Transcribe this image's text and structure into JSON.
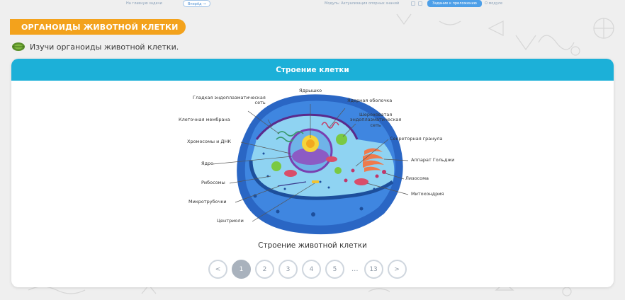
{
  "topbar": {
    "back_link": "На главную задачи",
    "next_pill": "Вперёд →",
    "mid_text": "Модуль: Актуализация опорных знаний",
    "cta_label": "Задание к приложению",
    "right_link": "О модуле"
  },
  "banner": {
    "title": "ОРГАНОИДЫ ЖИВОТНОЙ КЛЕТКИ"
  },
  "task": {
    "text": "Изучи органоиды животной клетки."
  },
  "card": {
    "header": "Строение клетки",
    "caption": "Строение животной клетки",
    "labels": {
      "smooth_er": "Гладкая эндоплазматическая\nсеть",
      "nucleolus": "Ядрышко",
      "nuclear_envelope": "Ядерная оболочка",
      "rough_er": "Шероховатая\nэндоплазматическая\nсеть",
      "cell_membrane": "Клеточная мембрана",
      "secretory_granule": "Секреторная гранула",
      "chromosomes": "Хромосомы и ДНК",
      "golgi": "Аппарат Гольджи",
      "nucleus": "Ядро",
      "lysosome": "Лизосома",
      "ribosomes": "Рибосомы",
      "mitochondria": "Митохондрия",
      "microtubules": "Микротрубочки",
      "centriole": "Центриоли"
    }
  },
  "pagination": {
    "prev": "<",
    "pages": [
      "1",
      "2",
      "3",
      "4",
      "5"
    ],
    "active": "1",
    "ellipsis": "...",
    "last": "13",
    "next": ">"
  },
  "colors": {
    "accent": "#1cb0d8",
    "banner": "#f3a21c",
    "cell_outer": "#2a66c4",
    "cytoplasm": "#8fd3f2"
  }
}
